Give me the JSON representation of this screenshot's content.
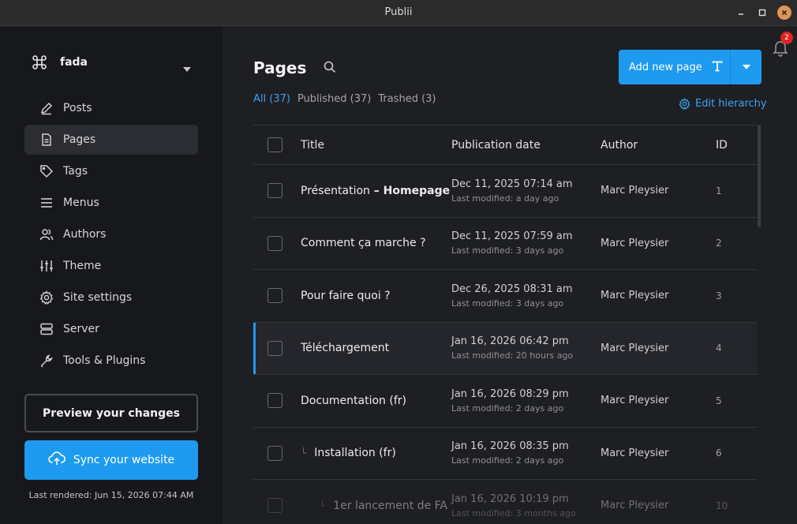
{
  "window": {
    "title": "Publii"
  },
  "site": {
    "name": "fada"
  },
  "nav": [
    {
      "label": "Posts",
      "icon": "pen-icon"
    },
    {
      "label": "Pages",
      "icon": "page-icon",
      "active": true
    },
    {
      "label": "Tags",
      "icon": "tag-icon"
    },
    {
      "label": "Menus",
      "icon": "menu-icon"
    },
    {
      "label": "Authors",
      "icon": "users-icon"
    },
    {
      "label": "Theme",
      "icon": "sliders-icon"
    },
    {
      "label": "Site settings",
      "icon": "gear-icon"
    },
    {
      "label": "Server",
      "icon": "server-icon"
    },
    {
      "label": "Tools & Plugins",
      "icon": "wrench-icon"
    }
  ],
  "actions": {
    "preview_label": "Preview your changes",
    "sync_label": "Sync your website",
    "last_rendered": "Last rendered: Jun 15, 2026 07:44 AM"
  },
  "header": {
    "title": "Pages",
    "add_label": "Add new page",
    "notifications_count": "2",
    "edit_hierarchy_label": "Edit hierarchy"
  },
  "filters": [
    {
      "label": "All (37)",
      "active": true
    },
    {
      "label": "Published (37)",
      "active": false
    },
    {
      "label": "Trashed (3)",
      "active": false
    }
  ],
  "table": {
    "columns": {
      "title": "Title",
      "date": "Publication date",
      "author": "Author",
      "id": "ID"
    },
    "rows": [
      {
        "title": "Présentation",
        "title_bold": " – Homepage",
        "date": "Dec 11, 2025 07:14 am",
        "modified": "Last modified: a day ago",
        "author": "Marc Pleysier",
        "id": "1",
        "level": 0
      },
      {
        "title": "Comment ça marche ?",
        "title_bold": "",
        "date": "Dec 11, 2025 07:59 am",
        "modified": "Last modified: 3 days ago",
        "author": "Marc Pleysier",
        "id": "2",
        "level": 0
      },
      {
        "title": "Pour faire quoi ?",
        "title_bold": "",
        "date": "Dec 26, 2025 08:31 am",
        "modified": "Last modified: 3 days ago",
        "author": "Marc Pleysier",
        "id": "3",
        "level": 0
      },
      {
        "title": "Téléchargement",
        "title_bold": "",
        "date": "Jan 16, 2026 06:42 pm",
        "modified": "Last modified: 20 hours ago",
        "author": "Marc Pleysier",
        "id": "4",
        "level": 0,
        "highlight": true
      },
      {
        "title": "Documentation (fr)",
        "title_bold": "",
        "date": "Jan 16, 2026 08:29 pm",
        "modified": "Last modified: 2 days ago",
        "author": "Marc Pleysier",
        "id": "5",
        "level": 0
      },
      {
        "title": "Installation (fr)",
        "title_bold": "",
        "date": "Jan 16, 2026 08:35 pm",
        "modified": "Last modified: 2 days ago",
        "author": "Marc Pleysier",
        "id": "6",
        "level": 1
      },
      {
        "title": "1er lancement de FA",
        "title_bold": "",
        "date": "Jan 16, 2026 10:19 pm",
        "modified": "Last modified: 3 months ago",
        "author": "Marc Pleysier",
        "id": "10",
        "level": 2,
        "faded": true
      }
    ]
  },
  "colors": {
    "accent": "#1e9bf0",
    "sidebar_bg": "#17181b",
    "main_bg": "#1e1f23",
    "badge": "#e02424"
  }
}
